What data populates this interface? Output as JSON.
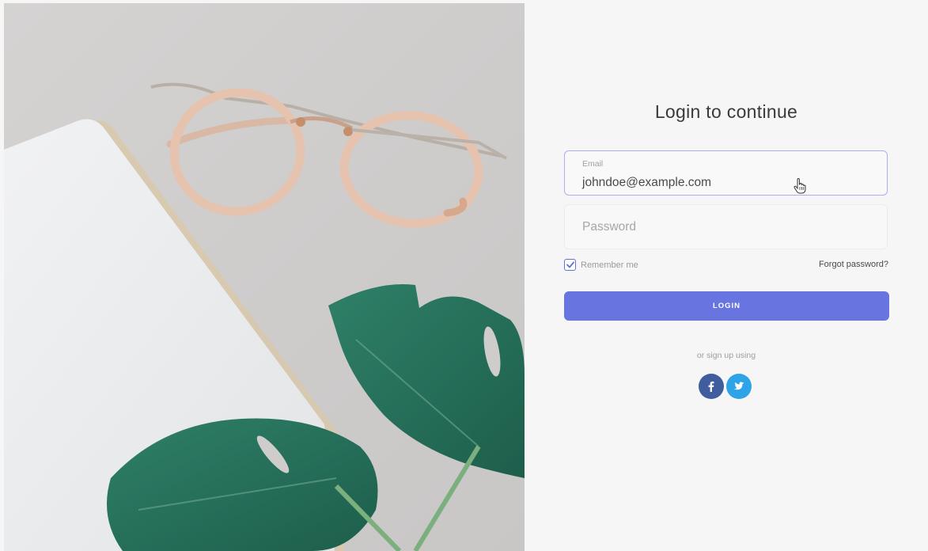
{
  "login": {
    "title": "Login to continue",
    "email": {
      "label": "Email",
      "value": "johndoe@example.com"
    },
    "password": {
      "placeholder": "Password"
    },
    "remember_me": {
      "label": "Remember me",
      "checked": true
    },
    "forgot_password": "Forgot password?",
    "submit_label": "LOGIN",
    "signup_text": "or sign up using",
    "social": [
      {
        "name": "facebook",
        "icon": "facebook-icon",
        "color": "#3f5e9e"
      },
      {
        "name": "twitter",
        "icon": "twitter-icon",
        "color": "#2ea3e8"
      }
    ]
  },
  "colors": {
    "accent": "#6874e0",
    "panel_background": "#f6f6f6",
    "field_focus_border": "#a9b0ea"
  }
}
